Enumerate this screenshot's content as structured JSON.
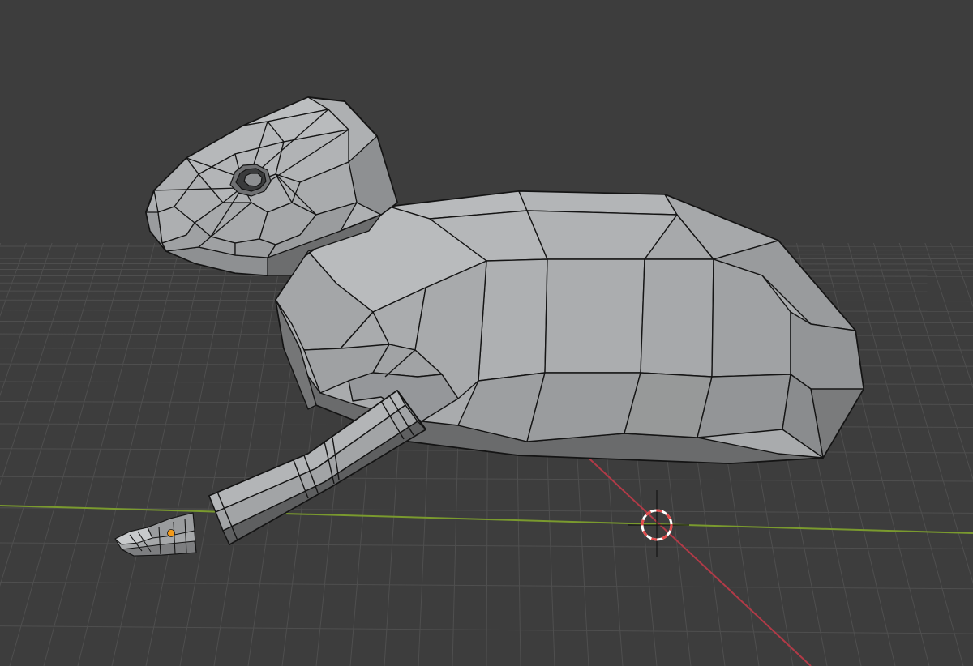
{
  "viewport": {
    "background": "#3d3d3d",
    "grid_color": "#4f4f4f",
    "x_axis_color": "#b13a47",
    "y_axis_color": "#7a9a2e",
    "mesh_fill": "#a9abad",
    "mesh_shadow": "#5e5f60",
    "wire_color": "#141414",
    "selected_origin_color": "#f39a1a",
    "cursor_colors": [
      "#e44b4b",
      "#ffffff"
    ]
  },
  "scene": {
    "objects": [
      {
        "name": "body"
      },
      {
        "name": "head"
      },
      {
        "name": "eye"
      },
      {
        "name": "front-leg"
      },
      {
        "name": "paw"
      }
    ],
    "icons": [
      "3d-cursor-icon",
      "object-origin-icon"
    ]
  }
}
